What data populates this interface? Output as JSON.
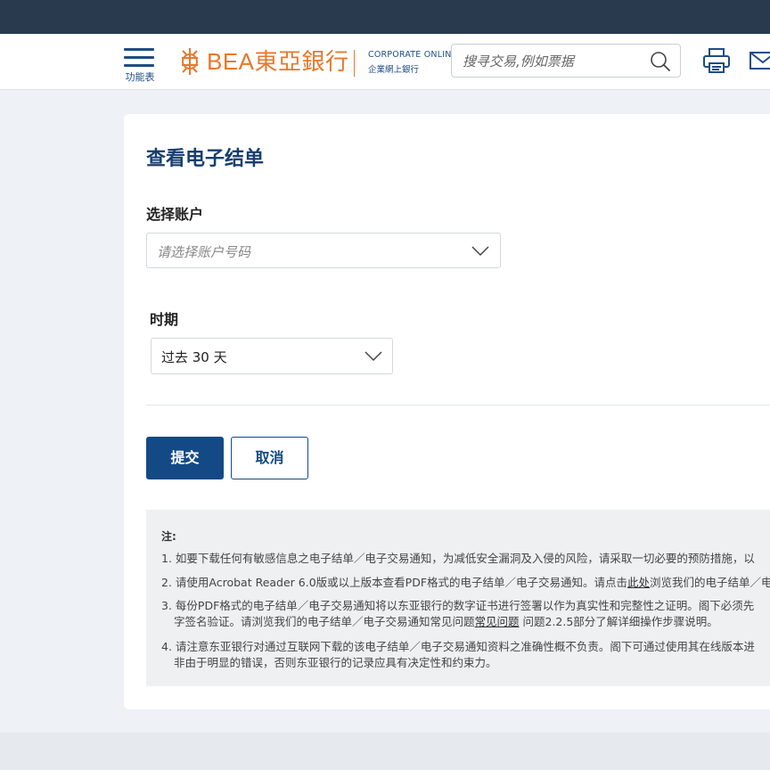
{
  "header": {
    "menu_label": "功能表",
    "logo_text": "BEA東亞銀行",
    "corporate_en": "CORPORATE ONLINE",
    "corporate_zh": "企業網上銀行",
    "search_placeholder": "搜寻交易,例如票据",
    "icons": [
      "menu-icon",
      "search-icon",
      "print-icon",
      "mail-icon"
    ]
  },
  "form": {
    "title": "查看电子结单",
    "account_label": "选择账户",
    "account_placeholder": "请选择账户号码",
    "period_label": "时期",
    "period_value": "过去 30 天",
    "submit_label": "提交",
    "cancel_label": "取消"
  },
  "notes": {
    "title": "注:",
    "note1": "1. 如要下载任何有敏感信息之电子结单／电子交易通知，为减低安全漏洞及入侵的风险，请采取一切必要的预防措施，以",
    "note2_pre": "2. 请使用Acrobat Reader 6.0版或以上版本查看PDF格式的电子结单／电子交易通知。请点击",
    "note2_link": "此处",
    "note2_post": "浏览我们的电子结单／电",
    "note3_line1": "3. 每份PDF格式的电子结单／电子交易通知将以东亚银行的数字证书进行签署以作为真实性和完整性之证明。阁下必须先",
    "note3_line2_pre": "字签名验证。请浏览我们的电子结单／电子交易通知常见问题",
    "note3_link": "常见问题",
    "note3_line2_post": " 问题2.2.5部分了解详细操作步骤说明。",
    "note4_line1": "4. 请注意东亚银行对通过互联网下载的该电子结单／电子交易通知资料之准确性概不负责。阁下可通过使用其在线版本进",
    "note4_line2": "非由于明显的错误，否则东亚银行的记录应具有决定性和约束力。"
  },
  "colors": {
    "brand_orange": "#e8782a",
    "brand_navy": "#134a85",
    "topbar": "#2a3a4e"
  }
}
